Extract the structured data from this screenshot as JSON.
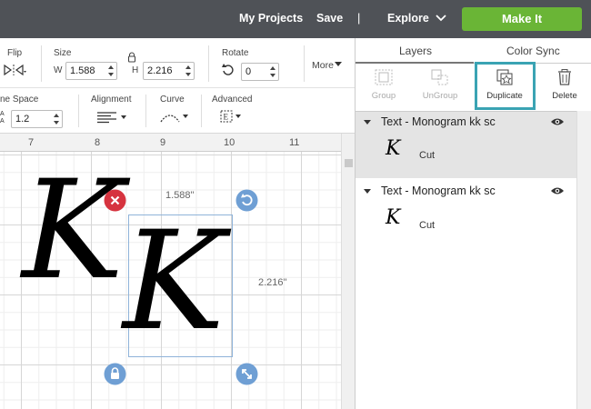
{
  "topbar": {
    "my_projects": "My Projects",
    "save": "Save",
    "separator": "|",
    "explore": "Explore",
    "make_it": "Make It"
  },
  "toolbar": {
    "flip_label": "Flip",
    "size_label": "Size",
    "w_label": "W",
    "w_value": "1.588",
    "h_label": "H",
    "h_value": "2.216",
    "rotate_label": "Rotate",
    "rotate_value": "0",
    "more_label": "More",
    "line_space_label": "ne Space",
    "line_space_value": "1.2",
    "alignment_label": "Alignment",
    "curve_label": "Curve",
    "advanced_label": "Advanced"
  },
  "canvas": {
    "ruler": [
      "7",
      "8",
      "9",
      "10",
      "11"
    ],
    "width_readout": "1.588\"",
    "height_readout": "2.216\"",
    "monogram_glyph": "K"
  },
  "panel": {
    "tabs": [
      "Layers",
      "Color Sync"
    ],
    "actions": [
      {
        "label": "Group",
        "enabled": false
      },
      {
        "label": "UnGroup",
        "enabled": false
      },
      {
        "label": "Duplicate",
        "enabled": true
      },
      {
        "label": "Delete",
        "enabled": true
      }
    ],
    "layers": [
      {
        "title": "Text - Monogram kk sc",
        "item_label": "Cut",
        "item_glyph": "K"
      },
      {
        "title": "Text - Monogram kk sc",
        "item_label": "Cut",
        "item_glyph": "K"
      }
    ]
  },
  "colors": {
    "topbar": "#4f5257",
    "make_it": "#6ab536",
    "highlight": "#3aa3b3",
    "delete_handle": "#d6333f",
    "handle_blue": "#6f9fd4",
    "selected_layer": "#e4e4e4"
  }
}
